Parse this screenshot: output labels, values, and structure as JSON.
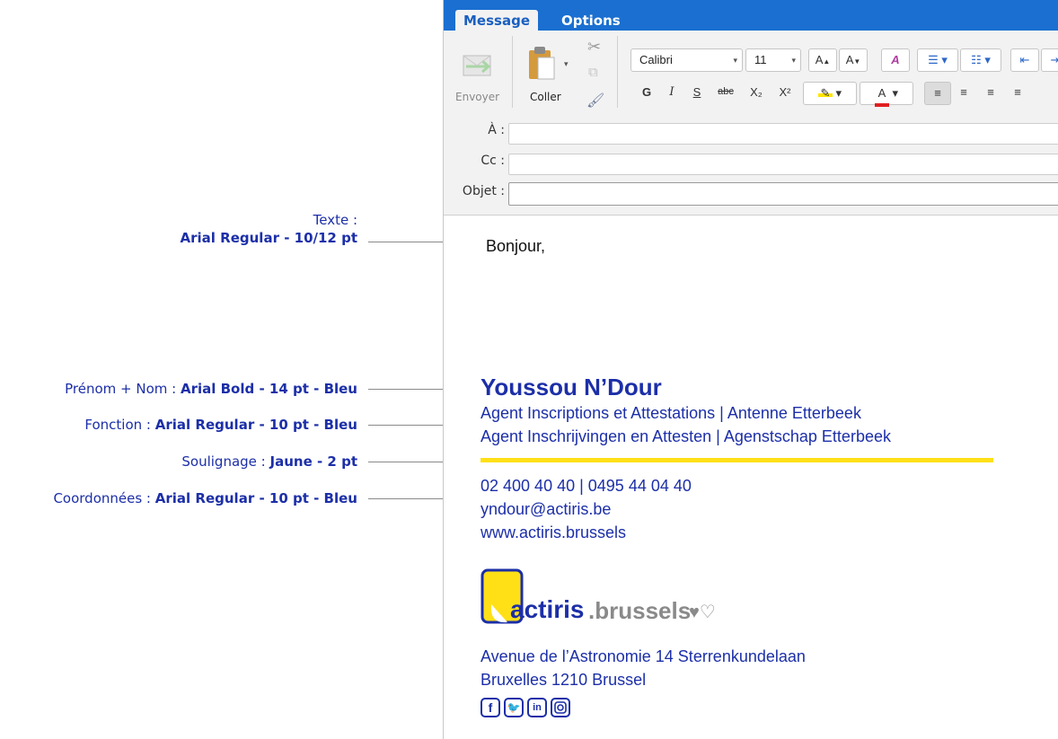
{
  "annotations": [
    {
      "label": "Texte :",
      "detail": "Arial Regular - 10/12 pt"
    },
    {
      "label": "Prénom + Nom :",
      "detail": "Arial Bold - 14 pt - Bleu"
    },
    {
      "label": "Fonction :",
      "detail": "Arial Regular - 10 pt  - Bleu"
    },
    {
      "label": "Soulignage :",
      "detail": "Jaune - 2 pt"
    },
    {
      "label": "Coordonnées :",
      "detail": "Arial Regular - 10 pt  - Bleu"
    }
  ],
  "tabs": {
    "active": "Message",
    "inactive": "Options"
  },
  "ribbon": {
    "send_label": "Envoyer",
    "paste_label": "Coller",
    "font_name": "Calibri",
    "font_size": "11",
    "bold": "G",
    "italic": "I",
    "underline": "S",
    "strike": "abc",
    "subscript": "X₂",
    "superscript": "X²"
  },
  "header_fields": {
    "to_label": "À :",
    "cc_label": "Cc :",
    "subject_label": "Objet :"
  },
  "body": {
    "greeting": "Bonjour,",
    "name": "Youssou N’Dour",
    "function_fr": "Agent Inscriptions et Attestations | Antenne Etterbeek",
    "function_nl": "Agent Inschrijvingen en Attesten | Agenstschap Etterbeek",
    "phones": "02 400 40 40 | 0495 44 04 40",
    "email": "yndour@actiris.be",
    "website": "www.actiris.brussels",
    "logo_text_main": "actiris",
    "logo_text_secondary": ".brussels",
    "address_line1": "Avenue de l’Astronomie 14 Sterrenkundelaan",
    "address_line2": "Bruxelles 1210 Brussel"
  },
  "social": [
    "facebook-icon",
    "twitter-icon",
    "linkedin-icon",
    "instagram-icon"
  ],
  "colors": {
    "brand_blue": "#1c2fa8",
    "accent_yellow": "#ffe017",
    "tab_blue": "#1a6fd0"
  }
}
